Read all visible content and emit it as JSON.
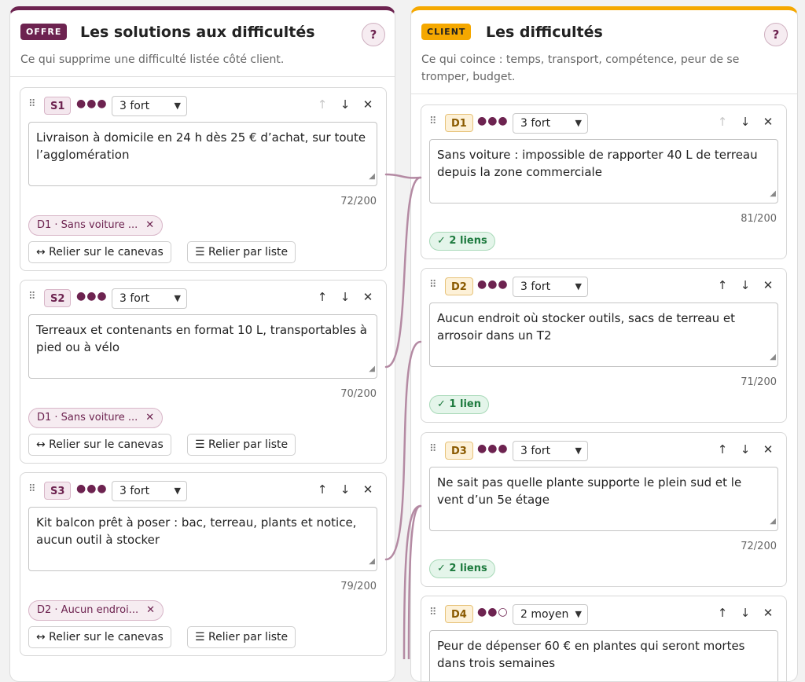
{
  "offre": {
    "tag": "OFFRE",
    "title": "Les solutions aux difficultés",
    "description": "Ce qui supprime une difficulté listée côté client.",
    "help": "?",
    "cards": [
      {
        "id": "S1",
        "dots": "●●●",
        "strength": "3 fort",
        "text": "Livraison à domicile en 24 h dès 25 € d’achat, sur toute l’agglomération",
        "counter": "72/200",
        "chip": "D1 · Sans voiture ...",
        "btn_canvas": "↔ Relier sur le canevas",
        "btn_list": "☰ Relier par liste",
        "up_disabled": true
      },
      {
        "id": "S2",
        "dots": "●●●",
        "strength": "3 fort",
        "text": "Terreaux et contenants en format 10 L, transportables à pied ou à vélo",
        "counter": "70/200",
        "chip": "D1 · Sans voiture ...",
        "btn_canvas": "↔ Relier sur le canevas",
        "btn_list": "☰ Relier par liste",
        "up_disabled": false
      },
      {
        "id": "S3",
        "dots": "●●●",
        "strength": "3 fort",
        "text": "Kit balcon prêt à poser : bac, terreau, plants et notice, aucun outil à stocker",
        "counter": "79/200",
        "chip": "D2 · Aucun endroi...",
        "btn_canvas": "↔ Relier sur le canevas",
        "btn_list": "☰ Relier par liste",
        "up_disabled": false
      }
    ]
  },
  "client": {
    "tag": "CLIENT",
    "title": "Les difficultés",
    "description": "Ce qui coince : temps, transport, compétence, peur de se tromper, budget.",
    "help": "?",
    "cards": [
      {
        "id": "D1",
        "dots": "●●●",
        "strength": "3 fort",
        "text": "Sans voiture : impossible de rapporter 40 L de terreau depuis la zone commerciale",
        "counter": "81/200",
        "links": "✓ 2 liens",
        "up_disabled": true
      },
      {
        "id": "D2",
        "dots": "●●●",
        "strength": "3 fort",
        "text": "Aucun endroit où stocker outils, sacs de terreau et arrosoir dans un T2",
        "counter": "71/200",
        "links": "✓ 1 lien",
        "up_disabled": false
      },
      {
        "id": "D3",
        "dots": "●●●",
        "strength": "3 fort",
        "text": "Ne sait pas quelle plante supporte le plein sud et le vent d’un 5e étage",
        "counter": "72/200",
        "links": "✓ 2 liens",
        "up_disabled": false
      },
      {
        "id": "D4",
        "dots": "●●○",
        "strength": "2 moyen",
        "text": "Peur de dépenser 60 € en plantes qui seront mortes dans trois semaines",
        "counter": "",
        "links": "",
        "up_disabled": false
      }
    ]
  },
  "icons": {
    "drag": "drag-handle-icon",
    "up": "arrow-up-icon",
    "down": "arrow-down-icon",
    "close": "close-icon",
    "chevron": "chevron-down-icon"
  },
  "colors": {
    "offre_accent": "#6d2350",
    "client_accent": "#f5a800",
    "connector": "#b48aa3",
    "link_badge": "#1d7a3e"
  }
}
